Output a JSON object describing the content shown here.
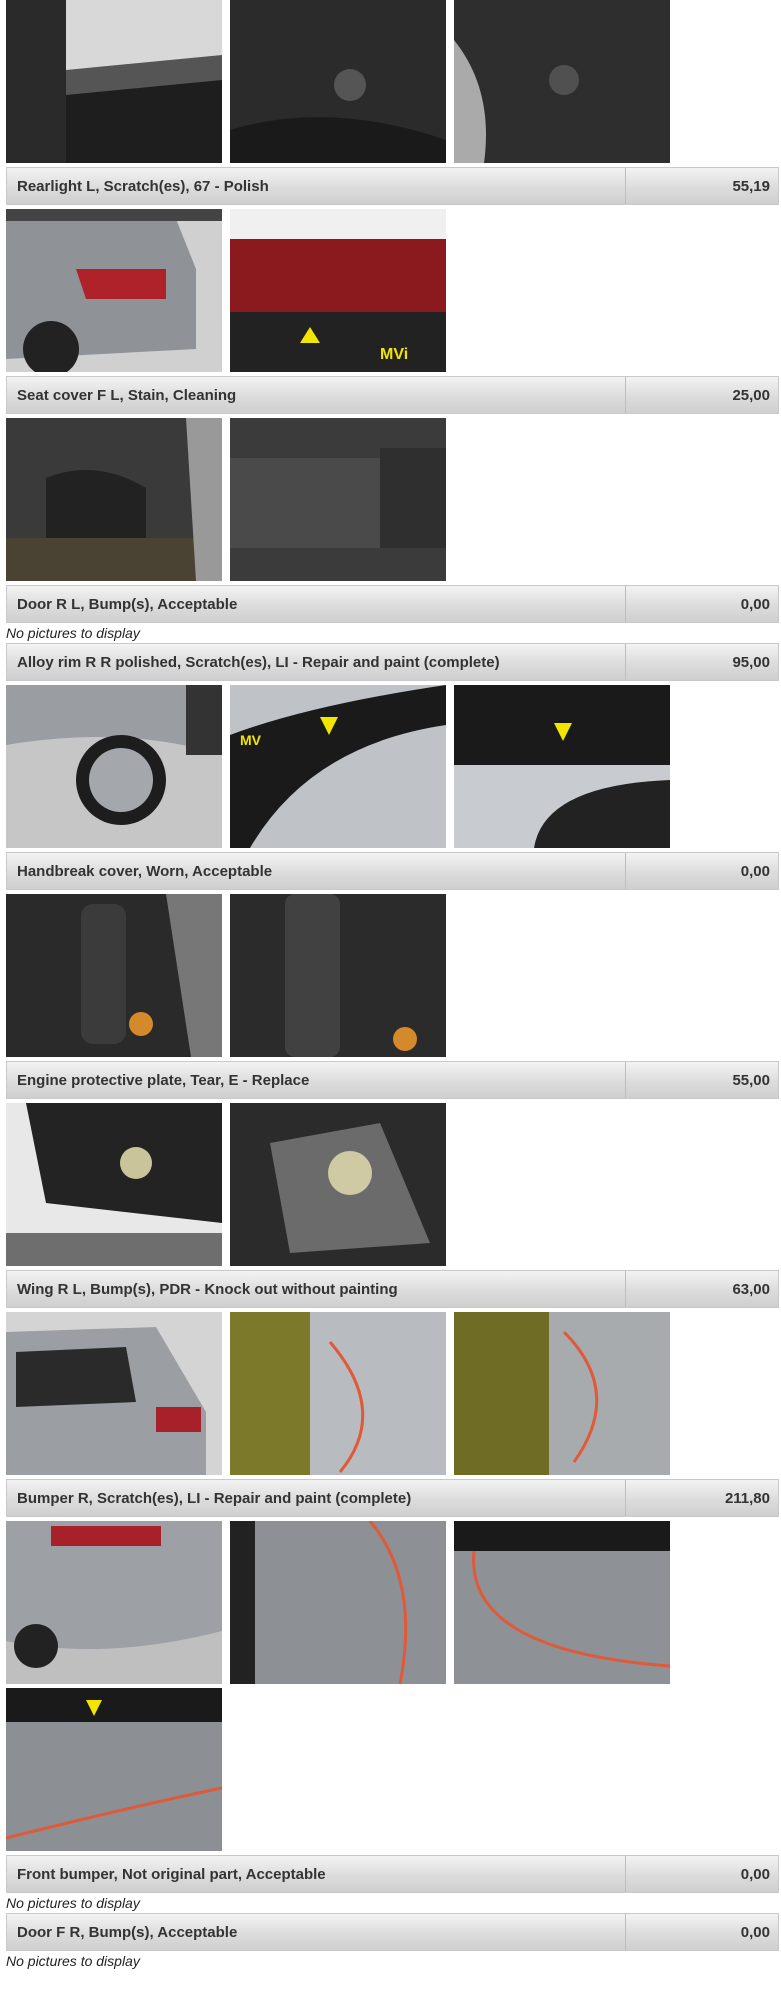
{
  "items": [
    {
      "label": "Rearlight L, Scratch(es), 67 - Polish",
      "price": "55,19"
    },
    {
      "label": "Seat cover F L, Stain, Cleaning",
      "price": "25,00"
    },
    {
      "label": "Door R L, Bump(s), Acceptable",
      "price": "0,00",
      "no_pictures": "No pictures to display"
    },
    {
      "label": "Alloy rim R R polished, Scratch(es), LI - Repair and paint (complete)",
      "price": "95,00"
    },
    {
      "label": "Handbreak cover, Worn, Acceptable",
      "price": "0,00"
    },
    {
      "label": "Engine protective plate, Tear, E - Replace",
      "price": "55,00"
    },
    {
      "label": "Wing R L, Bump(s), PDR - Knock out without painting",
      "price": "63,00"
    },
    {
      "label": "Bumper R, Scratch(es), LI - Repair and paint (complete)",
      "price": "211,80"
    },
    {
      "label": "Front bumper, Not original part, Acceptable",
      "price": "0,00",
      "no_pictures": "No pictures to display"
    },
    {
      "label": "Door F R, Bump(s), Acceptable",
      "price": "0,00",
      "no_pictures": "No pictures to display"
    }
  ]
}
